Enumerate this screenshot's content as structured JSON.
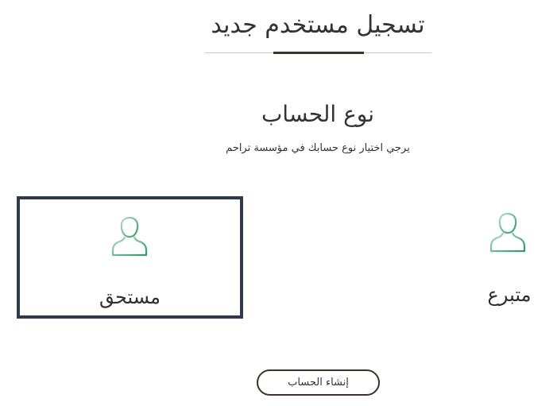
{
  "header": {
    "title": "تسجيل مستخدم جديد"
  },
  "account_type": {
    "title": "نوع الحساب",
    "subtitle": "يرجي اختيار نوع حسابك في مؤسسة تراحم"
  },
  "cards": {
    "beneficiary": {
      "label": "مستحق",
      "icon": "user-icon",
      "selected": true
    },
    "donor": {
      "label": "متبرع",
      "icon": "user-icon",
      "selected": false
    }
  },
  "actions": {
    "create_account_label": "إنشاء الحساب"
  },
  "colors": {
    "accent_dark": "#3d3225",
    "selected_border": "#2f3a4b",
    "icon_green_dark": "#2e9a66",
    "icon_green_light": "#b6e0c8"
  }
}
